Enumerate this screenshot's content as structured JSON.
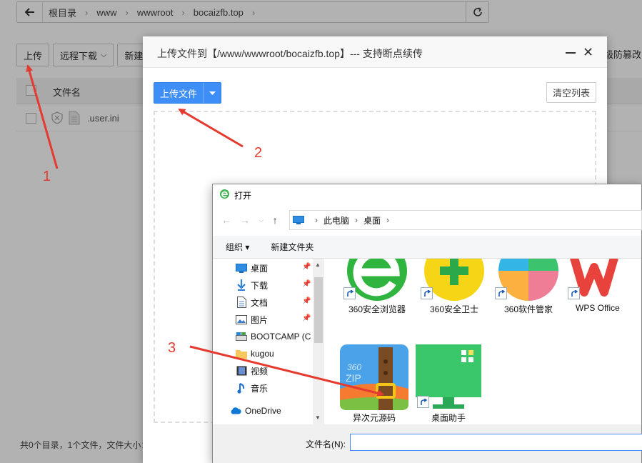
{
  "pathbar": {
    "crumbs": [
      "根目录",
      "www",
      "wwwroot",
      "bocaizfb.top"
    ]
  },
  "toolbar": {
    "upload_label": "上传",
    "remote_download_label": "远程下载",
    "new_label": "新建",
    "fav_label": "级防篡改"
  },
  "file_table": {
    "header_name": "文件名",
    "rows": [
      {
        "name": ".user.ini"
      }
    ]
  },
  "footer": {
    "summary": "共0个目录，1个文件，文件大小："
  },
  "upload_dialog": {
    "title": "上传文件到【/www/wwwroot/bocaizfb.top】--- 支持断点续传",
    "upload_button_label": "上传文件",
    "clear_button_label": "清空列表"
  },
  "open_dialog": {
    "title": "打开",
    "address": [
      "此电脑",
      "桌面"
    ],
    "organize_label": "组织 ▾",
    "new_folder_label": "新建文件夹",
    "tree": [
      {
        "label": "桌面",
        "icon": "desktop-icon",
        "pinned": true
      },
      {
        "label": "下载",
        "icon": "download-icon",
        "pinned": true
      },
      {
        "label": "文档",
        "icon": "document-icon",
        "pinned": true
      },
      {
        "label": "图片",
        "icon": "picture-icon",
        "pinned": true
      },
      {
        "label": "BOOTCAMP (C",
        "icon": "drive-icon",
        "pinned": false
      },
      {
        "label": "kugou",
        "icon": "folder-icon",
        "pinned": false
      },
      {
        "label": "视频",
        "icon": "video-icon",
        "pinned": false
      },
      {
        "label": "音乐",
        "icon": "music-icon",
        "pinned": false
      },
      {
        "label": "OneDrive",
        "icon": "cloud-icon",
        "pinned": false
      }
    ],
    "files": [
      {
        "label": "360安全浏览器",
        "icon": "360-browser-icon"
      },
      {
        "label": "360安全卫士",
        "icon": "360-guard-icon"
      },
      {
        "label": "360软件管家",
        "icon": "360-software-icon"
      },
      {
        "label": "WPS Office",
        "icon": "wps-icon"
      },
      {
        "label": "异次元源码",
        "icon": "zip-archive-icon"
      },
      {
        "label": "桌面助手",
        "icon": "desktop-assistant-icon"
      }
    ],
    "filename_label": "文件名(N):",
    "filename_value": ""
  },
  "annotations": [
    "1",
    "2",
    "3"
  ],
  "colors": {
    "accent": "#3e8ef7",
    "annotation": "#e53a2f"
  }
}
